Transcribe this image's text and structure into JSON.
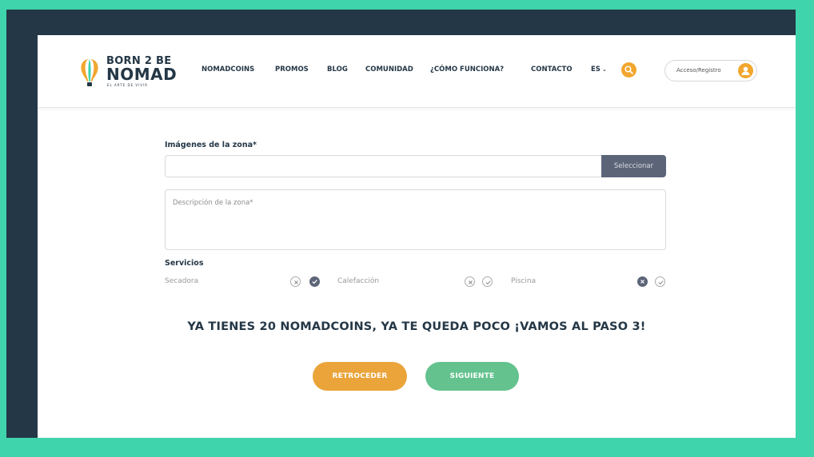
{
  "brand": {
    "line1": "BORN 2 BE",
    "line2": "NOMAD",
    "tagline": "EL ARTE DE VIVIR",
    "colors": {
      "navy": "#243746",
      "teal": "#3fd4ab",
      "orange": "#f2a62e",
      "green": "#63c28e",
      "slate": "#5c6578"
    }
  },
  "nav": {
    "items": [
      "NOMADCOINS",
      "PROMOS",
      "BLOG",
      "COMUNIDAD",
      "¿CÓMO FUNCIONA?",
      "CONTACTO"
    ],
    "language": "ES",
    "search_icon": "search-icon",
    "login_label": "Acceso/Registro",
    "login_icon": "user-icon"
  },
  "form": {
    "images_label": "Imágenes de la zona*",
    "images_value": "",
    "select_button": "Seleccionar",
    "description_placeholder": "Descripción de la zona*",
    "services_label": "Servicios",
    "services": [
      {
        "name": "Secadora",
        "state": "yes"
      },
      {
        "name": "Calefacción",
        "state": "none"
      },
      {
        "name": "Piscina",
        "state": "no"
      }
    ]
  },
  "banner": "YA TIENES 20 NOMADCOINS, YA TE QUEDA POCO ¡VAMOS AL PASO 3!",
  "buttons": {
    "back": "RETROCEDER",
    "next": "SIGUIENTE"
  }
}
